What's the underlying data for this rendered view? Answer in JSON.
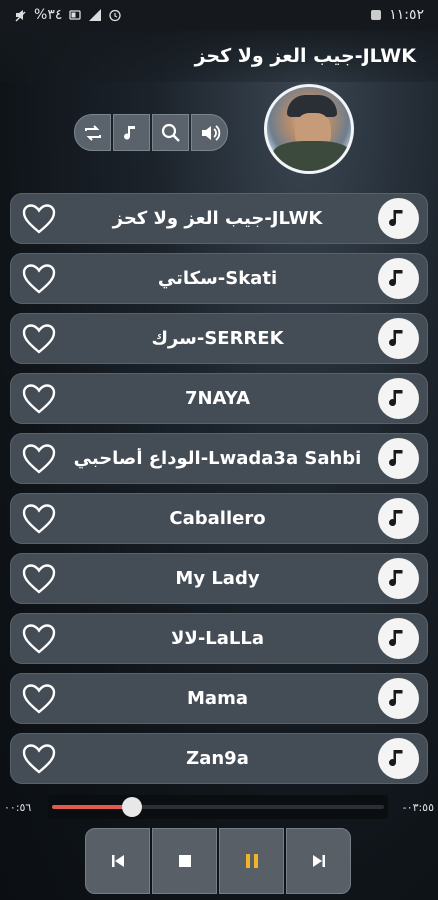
{
  "status_bar": {
    "battery_percent": "%٣٤",
    "time": "١١:٥٢"
  },
  "header": {
    "title": "جيب العز ولا كحز-JLWK"
  },
  "toolbar": {
    "buttons": [
      "repeat-icon",
      "music-note-icon",
      "search-icon",
      "volume-icon"
    ]
  },
  "songs": [
    {
      "title": "جيب العز ولا كحز-JLWK"
    },
    {
      "title": "سكاتي-Skati"
    },
    {
      "title": "سرك-SERREK"
    },
    {
      "title": "7NAYA"
    },
    {
      "title": "الوداع أصاحبي-Lwada3a Sahbi"
    },
    {
      "title": "Caballero"
    },
    {
      "title": "My Lady"
    },
    {
      "title": "لالا-LaLLa"
    },
    {
      "title": "Mama"
    },
    {
      "title": "Zan9a"
    }
  ],
  "player": {
    "elapsed": "٠٠:٥٦",
    "remaining": "-٠٣:٥٥",
    "progress": 0.24,
    "buttons": [
      "previous-icon",
      "stop-icon",
      "pause-icon",
      "next-icon"
    ]
  },
  "colors": {
    "accent": "#e05a4f",
    "pause": "#f0b429",
    "row_bg": "#444c55"
  }
}
